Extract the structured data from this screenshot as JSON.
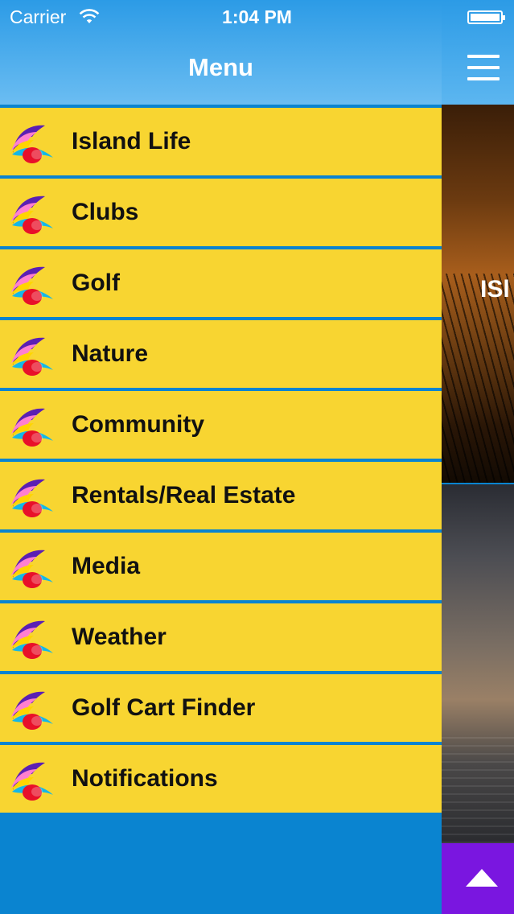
{
  "status_bar": {
    "carrier": "Carrier",
    "time": "1:04 PM"
  },
  "menu": {
    "title": "Menu",
    "items": [
      {
        "label": "Island Life"
      },
      {
        "label": "Clubs"
      },
      {
        "label": "Golf"
      },
      {
        "label": "Nature"
      },
      {
        "label": "Community"
      },
      {
        "label": "Rentals/Real Estate"
      },
      {
        "label": "Media"
      },
      {
        "label": "Weather"
      },
      {
        "label": "Golf Cart Finder"
      },
      {
        "label": "Notifications"
      }
    ]
  },
  "content": {
    "banner_text_visible": "ISl"
  },
  "icons": {
    "menu_item": "rainbow-logo-icon",
    "hamburger": "hamburger-icon",
    "scroll_top": "arrow-up-icon",
    "wifi": "wifi-icon",
    "battery": "battery-icon"
  },
  "colors": {
    "header_blue": "#2c9be6",
    "menu_yellow": "#f8d531",
    "divider_blue": "#0a84d0",
    "scroll_button_purple": "#7a16e0"
  }
}
